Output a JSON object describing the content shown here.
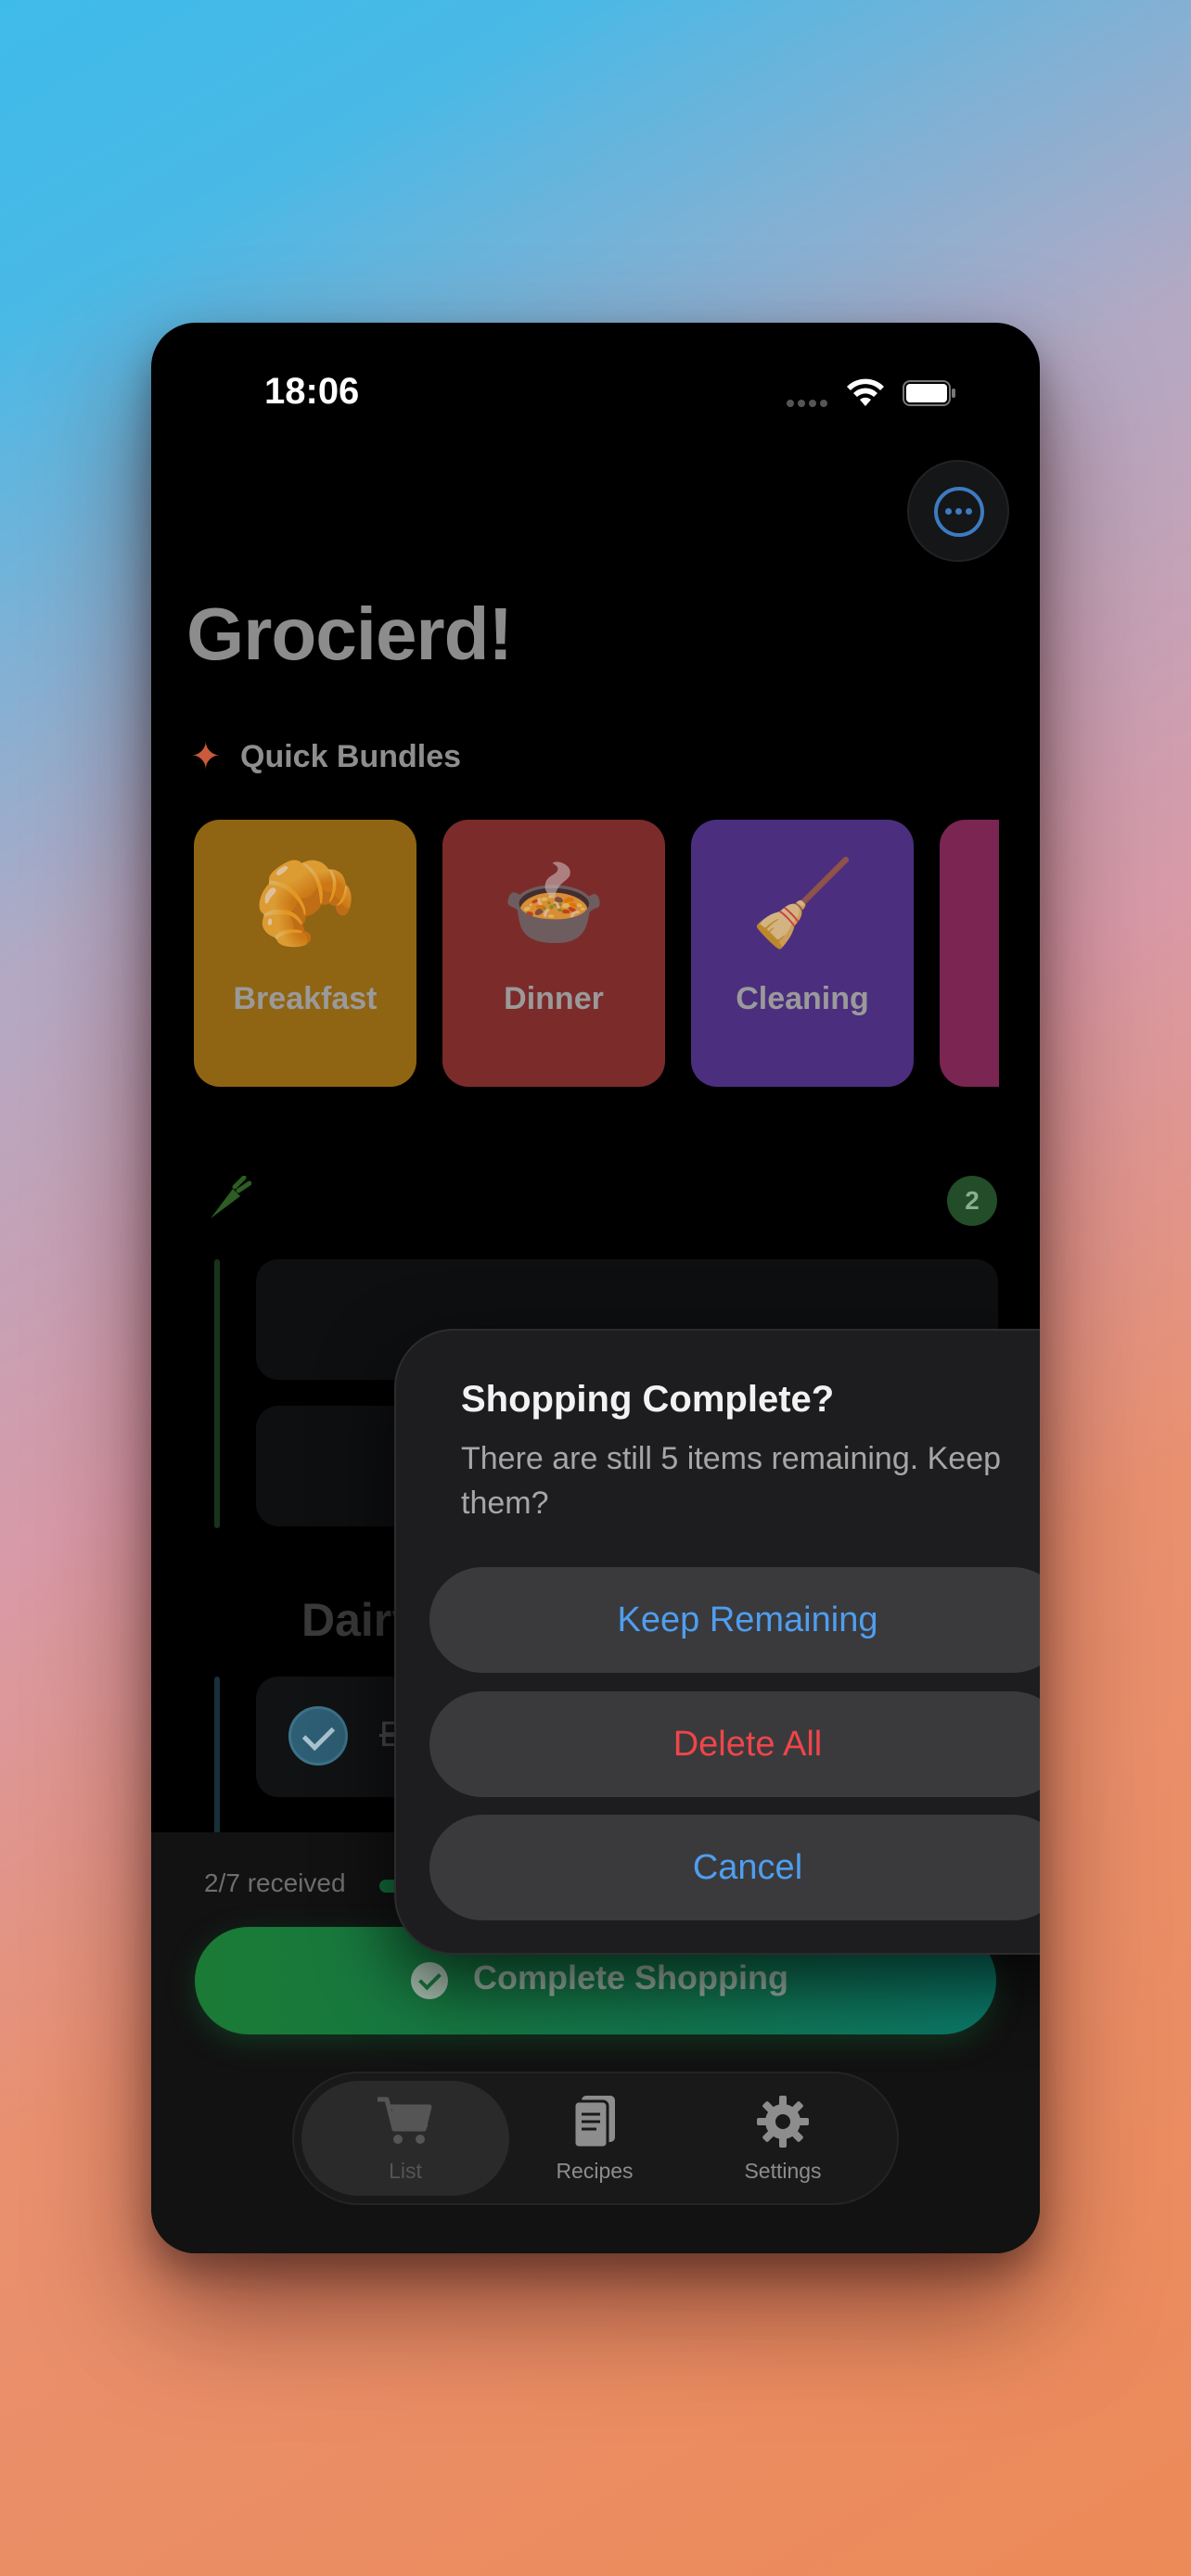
{
  "status_bar": {
    "time": "18:06"
  },
  "app": {
    "title": "Grocierd!"
  },
  "quick_bundles": {
    "label": "Quick Bundles",
    "items": [
      {
        "label": "Breakfast",
        "emoji": "🥐",
        "color": "#8f6413"
      },
      {
        "label": "Dinner",
        "emoji": "🍲",
        "color": "#7c2b2b"
      },
      {
        "label": "Cleaning",
        "emoji": "🧹",
        "color": "#4b2f7e"
      }
    ]
  },
  "categories": [
    {
      "icon": "carrot-icon",
      "count": "2"
    },
    {
      "icon": "coffee-cup-icon",
      "label": "Dairy",
      "items": [
        {
          "label": "Eggs",
          "checked": true
        }
      ]
    }
  ],
  "progress": {
    "text": "2/7 received",
    "fraction": 0.2857
  },
  "complete_button": {
    "label": "Complete Shopping"
  },
  "tabs": [
    {
      "label": "List",
      "icon": "cart-icon",
      "selected": true
    },
    {
      "label": "Recipes",
      "icon": "book-icon",
      "selected": false
    },
    {
      "label": "Settings",
      "icon": "gear-icon",
      "selected": false
    }
  ],
  "dialog": {
    "title": "Shopping Complete?",
    "message": "There are still 5 items remaining. Keep them?",
    "keep_label": "Keep Remaining",
    "delete_label": "Delete All",
    "cancel_label": "Cancel"
  },
  "colors": {
    "accent_blue": "#4f9ef0",
    "destructive_red": "#f0454a",
    "success_green": "#1b7a35"
  }
}
